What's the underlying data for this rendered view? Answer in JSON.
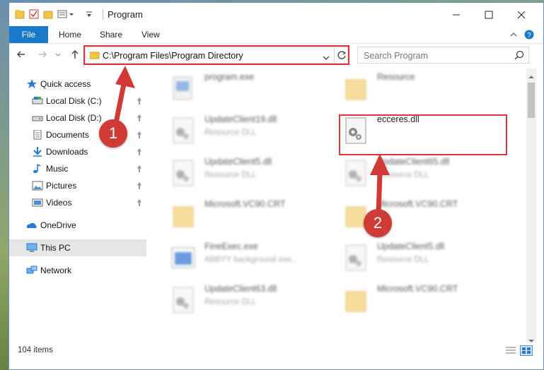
{
  "window": {
    "title": "Program"
  },
  "ribbon": {
    "file": "File",
    "home": "Home",
    "share": "Share",
    "view": "View"
  },
  "address": {
    "path": "C:\\Program Files\\Program Directory"
  },
  "search": {
    "placeholder": "Search Program"
  },
  "sidebar": {
    "items": [
      {
        "label": "Quick access"
      },
      {
        "label": "Local Disk (C:)"
      },
      {
        "label": "Local Disk (D:)"
      },
      {
        "label": "Documents"
      },
      {
        "label": "Downloads"
      },
      {
        "label": "Music"
      },
      {
        "label": "Pictures"
      },
      {
        "label": "Videos"
      },
      {
        "label": "OneDrive"
      },
      {
        "label": "This PC"
      },
      {
        "label": "Network"
      }
    ]
  },
  "files": [
    {
      "name": "program.exe",
      "sub": ""
    },
    {
      "name": "Resource",
      "sub": ""
    },
    {
      "name": "UpdateClient19.dll",
      "sub": "Resource DLL"
    },
    {
      "name": "ecceres.dll",
      "sub": ""
    },
    {
      "name": "UpdateClient5.dll",
      "sub": "Resource DLL"
    },
    {
      "name": "UpdateClient65.dll",
      "sub": "Resource DLL"
    },
    {
      "name": "Microsoft.VC90.CRT",
      "sub": ""
    },
    {
      "name": "Microsoft.VC90.CRT",
      "sub": ""
    },
    {
      "name": "FineExec.exe",
      "sub": "ABBYY background exe..."
    },
    {
      "name": "UpdateClient5.dll",
      "sub": "Resource DLL"
    },
    {
      "name": "UpdateClient63.dll",
      "sub": "Resource DLL"
    },
    {
      "name": "Microsoft.VC90.CRT",
      "sub": ""
    }
  ],
  "status": {
    "count": "104 items"
  },
  "callouts": {
    "one": "1",
    "two": "2"
  },
  "colors": {
    "accent": "#1979ca",
    "highlight": "#d9363e"
  }
}
